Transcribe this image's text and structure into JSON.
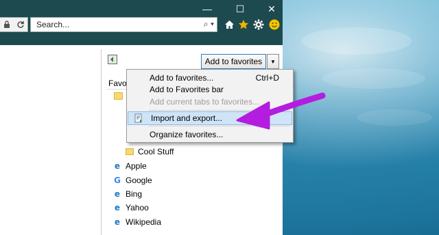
{
  "window": {
    "controls": {
      "minimize": "—",
      "maximize": "☐",
      "close": "✕"
    },
    "search": {
      "placeholder": "Search...",
      "dropdown_glyph": "⌕ ▾"
    }
  },
  "toolbar": {
    "icons": [
      "home-icon",
      "favorites-star-icon",
      "settings-gear-icon",
      "feedback-smiley-icon"
    ],
    "star_color": "#f2b400",
    "smiley_color": "#f5c400"
  },
  "favorites_panel": {
    "add_button_label": "Add to favorites",
    "dropdown_arrow": "▼",
    "label_fragment": "Favo",
    "folders": [
      "Cool Stuff"
    ],
    "links": [
      {
        "label": "Apple",
        "icon": "ie-icon"
      },
      {
        "label": "Google",
        "icon": "google-icon"
      },
      {
        "label": "Bing",
        "icon": "ie-icon"
      },
      {
        "label": "Yahoo",
        "icon": "ie-icon"
      },
      {
        "label": "Wikipedia",
        "icon": "ie-icon"
      }
    ]
  },
  "menu": {
    "items": [
      {
        "label": "Add to favorites...",
        "shortcut": "Ctrl+D",
        "disabled": false
      },
      {
        "label": "Add to Favorites bar",
        "shortcut": "",
        "disabled": false
      },
      {
        "label": "Add current tabs to favorites...",
        "shortcut": "",
        "disabled": true
      },
      {
        "label": "Import and export...",
        "shortcut": "",
        "disabled": false,
        "highlighted": true
      },
      {
        "label": "Organize favorites...",
        "shortcut": "",
        "disabled": false
      }
    ]
  },
  "annotation": {
    "arrow_color": "#b41de0"
  },
  "colors": {
    "titlebar": "#1d4a4f",
    "menu_highlight": "#cfe4f7",
    "accent_border": "#2f7bbd"
  }
}
